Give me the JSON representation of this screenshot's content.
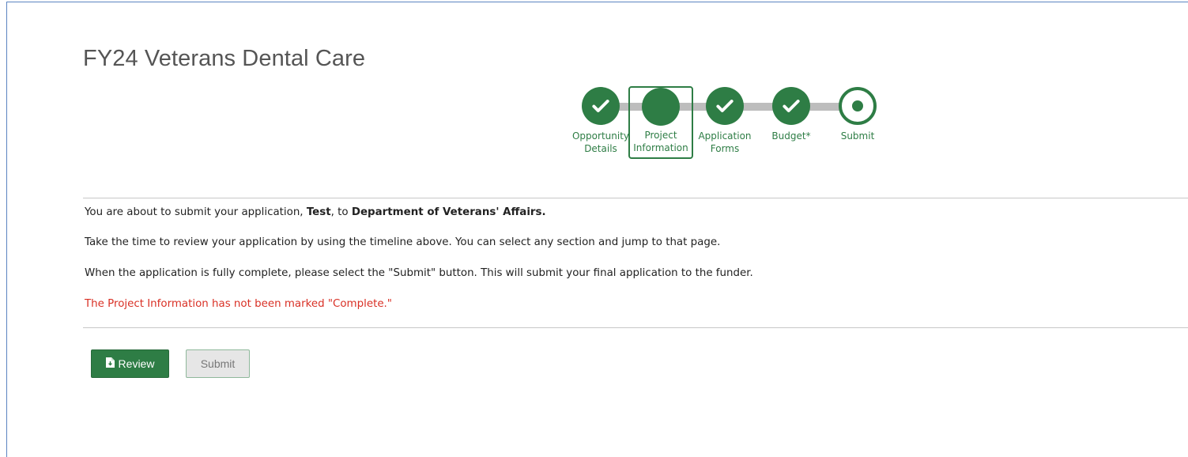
{
  "page": {
    "title": "FY24 Veterans Dental Care"
  },
  "timeline": {
    "steps": [
      {
        "label": "Opportunity Details",
        "line1": "Opportunity",
        "line2": "Details",
        "state": "complete",
        "icon": "check-icon"
      },
      {
        "label": "Project Information",
        "line1": "Project",
        "line2": "Information",
        "state": "current",
        "icon": "filled-circle"
      },
      {
        "label": "Application Forms",
        "line1": "Application",
        "line2": "Forms",
        "state": "complete",
        "icon": "check-icon"
      },
      {
        "label": "Budget*",
        "line1": "Budget*",
        "line2": "",
        "state": "complete",
        "icon": "check-icon"
      },
      {
        "label": "Submit",
        "line1": "Submit",
        "line2": "",
        "state": "pending",
        "icon": "radio-dot-icon"
      }
    ]
  },
  "messages": {
    "intro_prefix": "You are about to submit your application, ",
    "application_name": "Test",
    "intro_middle": ", to ",
    "funder_name": "Department of Veterans' Affairs.",
    "review_hint": "Take the time to review your application by using the timeline above. You can select any section and jump to that page.",
    "submit_hint": "When the application is fully complete, please select the \"Submit\" button. This will submit your final application to the funder.",
    "warning": "The Project Information has not been marked \"Complete.\""
  },
  "actions": {
    "review_label": "Review",
    "submit_label": "Submit"
  },
  "colors": {
    "primary_green": "#2e7d45",
    "warning_red": "#d93025",
    "border_blue": "#5b84c1"
  }
}
